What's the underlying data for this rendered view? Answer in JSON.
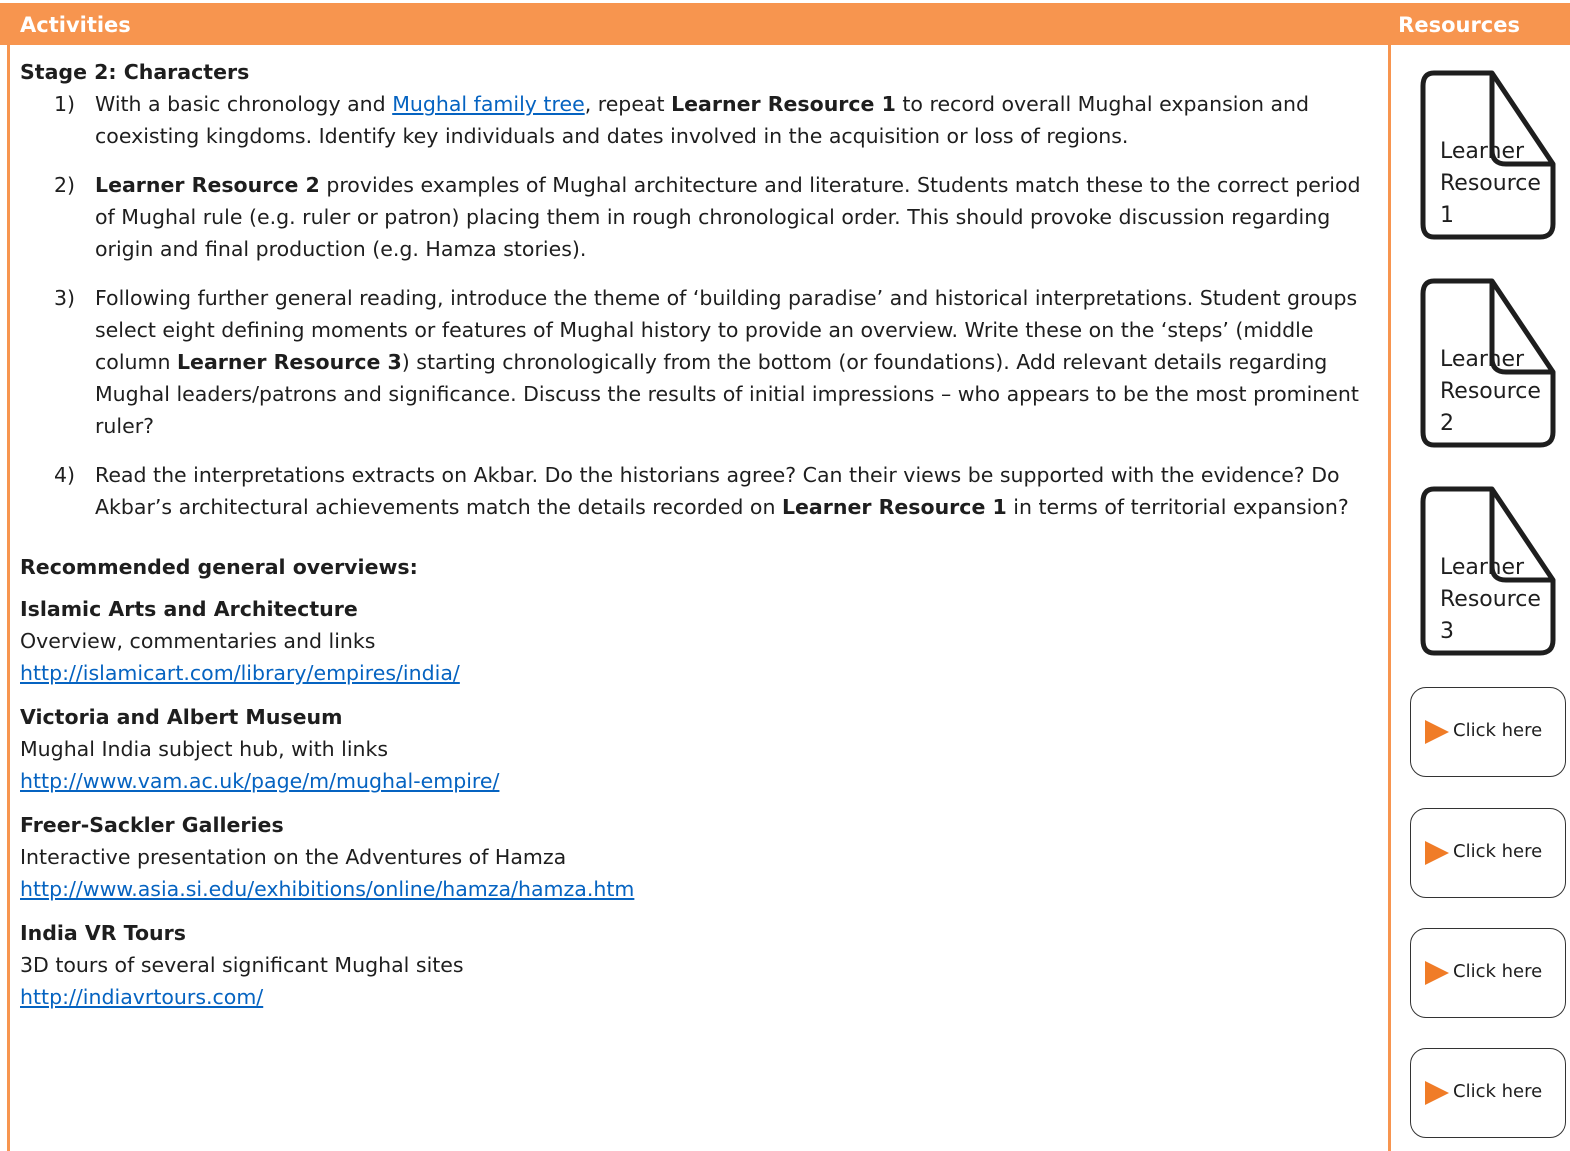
{
  "header": {
    "activities": "Activities",
    "resources": "Resources"
  },
  "stage": {
    "title": "Stage 2: Characters",
    "steps": [
      {
        "num": "1)",
        "p1": "With a basic chronology and ",
        "link": "Mughal family tree",
        "p2": ", repeat ",
        "b1": "Learner Resource 1",
        "p3": " to record overall Mughal expansion and coexisting kingdoms. Identify key individuals and dates involved in the acquisition or loss of regions."
      },
      {
        "num": "2)",
        "b1": "Learner Resource 2",
        "p1": " provides examples of Mughal architecture and literature. Students match these to the correct period of Mughal rule (e.g. ruler or patron) placing them in rough chronological order. This should provoke discussion regarding origin and final production (e.g. Hamza stories)."
      },
      {
        "num": "3)",
        "p1": "Following further general reading, introduce the theme of ‘building paradise’ and historical interpretations. Student groups select eight defining moments or features of Mughal history to provide an overview. Write these on the ‘steps’ (middle column ",
        "b1": "Learner Resource 3",
        "p2": ") starting chronologically from the bottom (or foundations). Add relevant details regarding Mughal leaders/patrons and significance. Discuss the results of initial impressions – who appears to be the most prominent ruler?"
      },
      {
        "num": "4)",
        "p1": "Read the interpretations extracts on Akbar. Do the historians agree? Can their views be supported with the evidence? Do Akbar’s architectural achievements match the details recorded on ",
        "b1": "Learner Resource 1",
        "p2": " in terms of territorial expansion?"
      }
    ]
  },
  "overviews": {
    "title": "Recommended general overviews:",
    "items": [
      {
        "title": "Islamic Arts and Architecture",
        "desc": "Overview, commentaries and links",
        "url": "http://islamicart.com/library/empires/india/"
      },
      {
        "title": "Victoria and Albert Museum",
        "desc": "Mughal India subject hub, with links",
        "url": "http://www.vam.ac.uk/page/m/mughal-empire/"
      },
      {
        "title": "Freer-Sackler Galleries",
        "desc": "Interactive presentation on the Adventures of Hamza",
        "url": "http://www.asia.si.edu/exhibitions/online/hamza/hamza.htm"
      },
      {
        "title": "India VR Tours",
        "desc": "3D tours of several significant Mughal sites",
        "url": "http://indiavrtours.com/"
      }
    ]
  },
  "sidebar": {
    "docs": [
      {
        "line1": "Learner",
        "line2": "Resource",
        "line3": "1"
      },
      {
        "line1": "Learner",
        "line2": "Resource",
        "line3": "2"
      },
      {
        "line1": "Learner",
        "line2": "Resource",
        "line3": "3"
      }
    ],
    "click_label": "Click here",
    "play_icon": "play-triangle",
    "accent": "#f7954f"
  }
}
